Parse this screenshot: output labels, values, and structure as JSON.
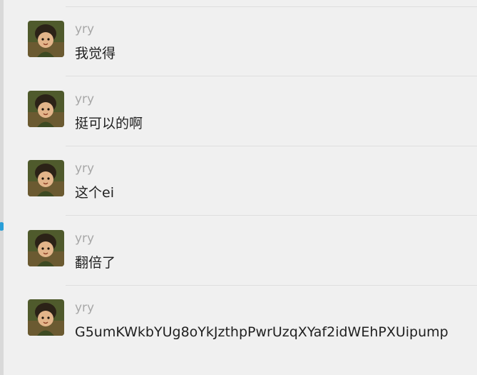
{
  "chat": {
    "messages": [
      {
        "sender": "yry",
        "text": "我觉得"
      },
      {
        "sender": "yry",
        "text": "挺可以的啊"
      },
      {
        "sender": "yry",
        "text": "这个ei"
      },
      {
        "sender": "yry",
        "text": "翻倍了"
      },
      {
        "sender": "yry",
        "text": "G5umKWkbYUg8oYkJzthpPwrUzqXYaf2idWEhPXUipump"
      }
    ]
  },
  "colors": {
    "background": "#f0f0f0",
    "sender_name": "#a7a7a7",
    "message_text": "#1f1f1f",
    "separator": "#dedede",
    "left_strip": "#d9d9d9",
    "unread_accent": "#2a9fd8"
  },
  "icons": {
    "avatar": "avatar-image"
  }
}
